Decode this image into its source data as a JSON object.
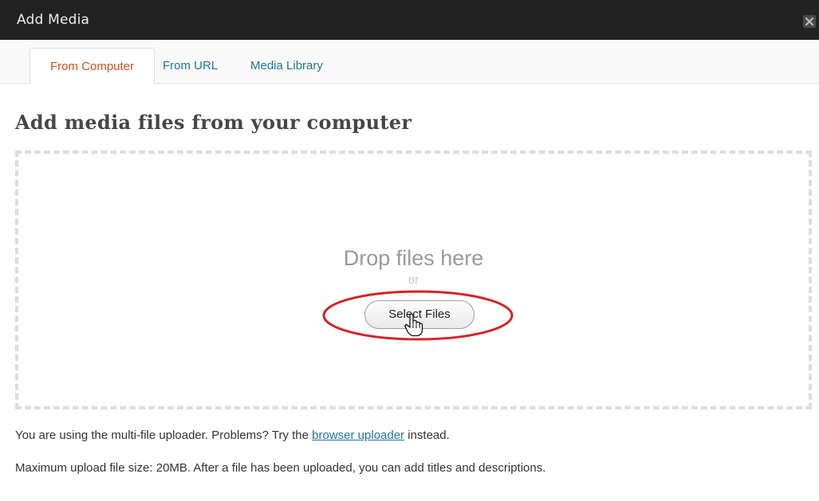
{
  "window": {
    "title": "Add Media",
    "close_icon": "close-icon"
  },
  "tabs": [
    {
      "label": "From Computer",
      "active": true
    },
    {
      "label": "From URL",
      "active": false
    },
    {
      "label": "Media Library",
      "active": false
    }
  ],
  "main": {
    "heading": "Add media files from your computer",
    "dropzone": {
      "drop_text": "Drop files here",
      "or_text": "or",
      "select_button": "Select Files"
    },
    "info_line_1": {
      "prefix": "You are using the multi-file uploader. Problems? Try the ",
      "link": "browser uploader",
      "suffix": " instead."
    },
    "info_line_2": "Maximum upload file size: 20MB. After a file has been uploaded, you can add titles and descriptions."
  },
  "colors": {
    "titlebar_bg": "#222222",
    "active_tab": "#d54e21",
    "link": "#21759b",
    "highlight_ring": "#d4242a"
  }
}
